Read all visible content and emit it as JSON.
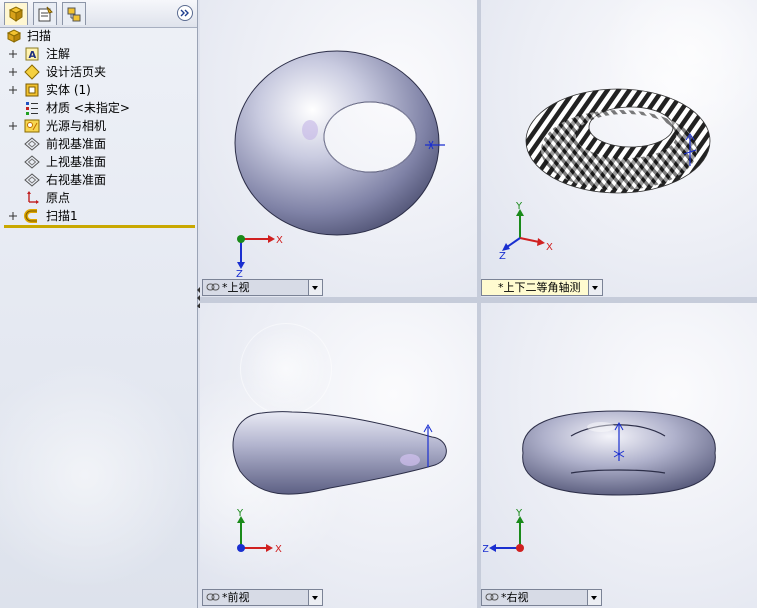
{
  "feature_tree": {
    "root_label": "扫描",
    "items": [
      {
        "label": "注解",
        "icon": "annotations-icon",
        "expandable": true
      },
      {
        "label": "设计活页夹",
        "icon": "design-binder-icon",
        "expandable": true
      },
      {
        "label": "实体 (1)",
        "icon": "solid-bodies-icon",
        "expandable": true
      },
      {
        "label": "材质 <未指定>",
        "icon": "material-icon",
        "expandable": false
      },
      {
        "label": "光源与相机",
        "icon": "lights-cameras-icon",
        "expandable": true
      },
      {
        "label": "前视基准面",
        "icon": "plane-icon",
        "expandable": false
      },
      {
        "label": "上视基准面",
        "icon": "plane-icon",
        "expandable": false
      },
      {
        "label": "右视基准面",
        "icon": "plane-icon",
        "expandable": false
      },
      {
        "label": "原点",
        "icon": "origin-icon",
        "expandable": false
      },
      {
        "label": "扫描1",
        "icon": "sweep-feature-icon",
        "expandable": true
      }
    ]
  },
  "viewports": {
    "top_left": {
      "view_name": "*上视",
      "axis_labels": [
        "X",
        "Z"
      ]
    },
    "top_right": {
      "view_name": "*上下二等角轴测",
      "axis_labels": [
        "Y",
        "Z",
        "X"
      ],
      "display": "zebra-stripes"
    },
    "bottom_left": {
      "view_name": "*前视",
      "axis_labels": [
        "Y",
        "X"
      ]
    },
    "bottom_right": {
      "view_name": "*右视",
      "axis_labels": [
        "Y",
        "Z"
      ]
    }
  },
  "colors": {
    "rollback_bar": "#c9a800",
    "axis_x": "#d02020",
    "axis_y": "#1a8a1a",
    "axis_z": "#1a2fd0",
    "active_view_dropdown": "#fffbd0"
  }
}
